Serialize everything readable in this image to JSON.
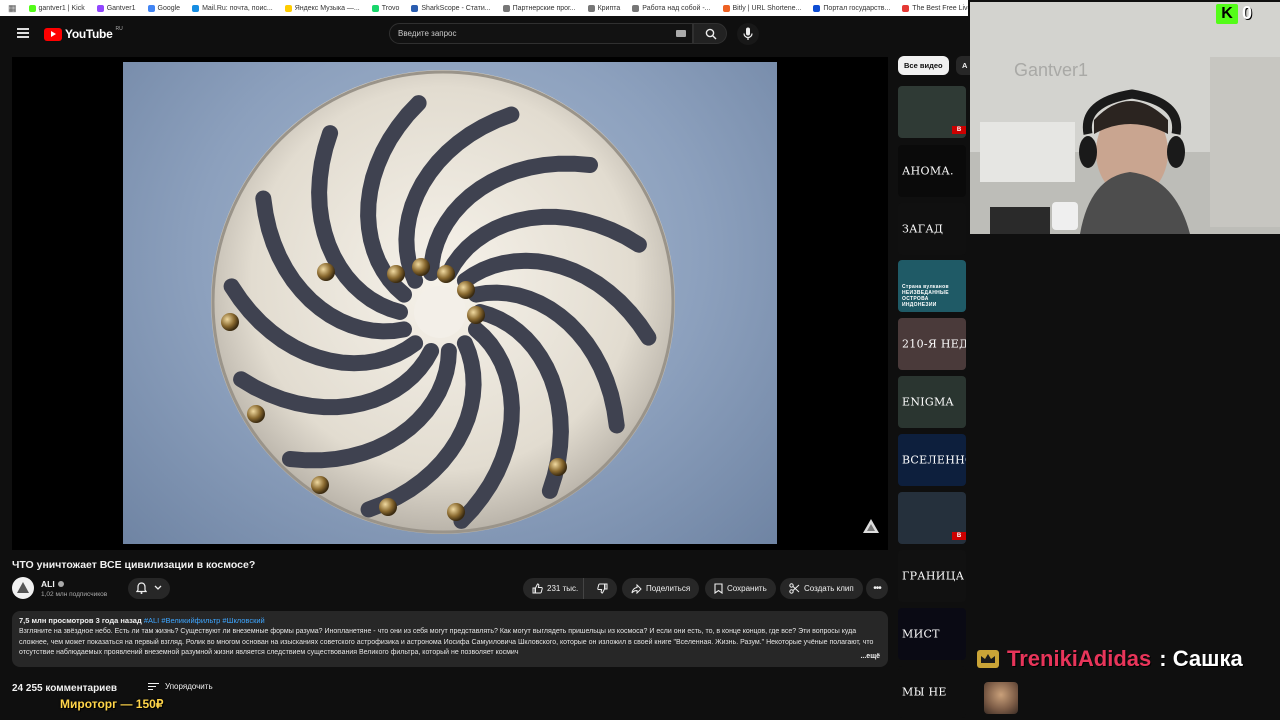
{
  "bookmarks": [
    {
      "label": "gantver1 | Kick",
      "color": "#53fc18"
    },
    {
      "label": "Gantver1",
      "color": "#9146ff"
    },
    {
      "label": "Google",
      "color": "#4285f4"
    },
    {
      "label": "Mail.Ru: почта, поис...",
      "color": "#168de2"
    },
    {
      "label": "Яндекс Музыка —...",
      "color": "#ffcc00"
    },
    {
      "label": "Trovo",
      "color": "#19d66b"
    },
    {
      "label": "SharkScope - Стати...",
      "color": "#2a5db0"
    },
    {
      "label": "Партнерские прог...",
      "color": "#777777"
    },
    {
      "label": "Крипта",
      "color": "#777777"
    },
    {
      "label": "Работа над собой -...",
      "color": "#777777"
    },
    {
      "label": "Bitly | URL Shortene...",
      "color": "#ee6123"
    },
    {
      "label": "Портал государств...",
      "color": "#0d4cd3"
    },
    {
      "label": "The Best Free Live S...",
      "color": "#e53935"
    }
  ],
  "header": {
    "logo_text": "YouTube",
    "region": "RU",
    "search_placeholder": "Введите запрос"
  },
  "video": {
    "title": "ЧТО уничтожает ВСЕ цивилизации в космосе?",
    "channel_name": "ALI",
    "subscribers": "1,02 млн подписчиков",
    "likes": "231 тыс.",
    "share_label": "Поделиться",
    "save_label": "Сохранить",
    "clip_label": "Создать клип",
    "more_label": "•••"
  },
  "description": {
    "meta": "7,5 млн просмотров  3 года назад",
    "tags": "#ALI #Великийфильтр #Шкловский",
    "text": "Взгляните на звёздное небо. Есть ли там жизнь? Существуют ли внеземные формы разума? Инопланетяне - что они из себя могут представлять? Как могут выглядеть пришельцы из космоса? И если они есть, то, в конце концов, где все? Эти вопросы куда сложнее, чем может показаться на первый взгляд. Ролик во многом основан на изысканиях советского астрофизика и астронома Иосифа Самуиловича Шкловского, которые он изложил в своей книге \"Вселенная. Жизнь. Разум.\" Некоторые учёные полагают, что отсутствие наблюдаемых проявлений внеземной разумной жизни является следствием существования Великого фильтра, который не позволяет космич",
    "more_label": "...ещё"
  },
  "comments": {
    "count_label": "24 255 комментариев",
    "sort_label": "Упорядочить"
  },
  "overlay": {
    "price_text": "Мироторг — 150₽"
  },
  "sidebar": {
    "chip_all": "Все видео",
    "chip_next": "А",
    "thumbnails": [
      {
        "text": "",
        "bg": "#2f3a35",
        "live": "В"
      },
      {
        "text": "АНОМА.",
        "bg": "#0a0a0a",
        "live": ""
      },
      {
        "text": "ЗАГАД",
        "bg": "#101010",
        "live": ""
      },
      {
        "text": "Страна вулканов НЕИЗВЕДАННЫЕ ОСТРОВА ИНДОНЕЗИИ",
        "bg": "#1f5a66",
        "live": ""
      },
      {
        "text": "210-Я НЕДЕЛЯ",
        "bg": "#4a3a3a",
        "live": ""
      },
      {
        "text": "ENIGMA",
        "bg": "#2a3530",
        "live": ""
      },
      {
        "text": "ВСЕЛЕННО",
        "bg": "#0d1f3d",
        "live": ""
      },
      {
        "text": "",
        "bg": "#25303c",
        "live": "В"
      },
      {
        "text": "ГРАНИЦА",
        "bg": "#111111",
        "live": ""
      },
      {
        "text": "МИСТ",
        "bg": "#0a0a14",
        "live": ""
      },
      {
        "text": "МЫ НЕ",
        "bg": "#0f0f0f",
        "live": ""
      }
    ]
  },
  "stream": {
    "kick_viewers": "0",
    "wall_text": "Gantver1",
    "chat_user": "TrenikiAdidas",
    "chat_message": ": Сашка"
  }
}
